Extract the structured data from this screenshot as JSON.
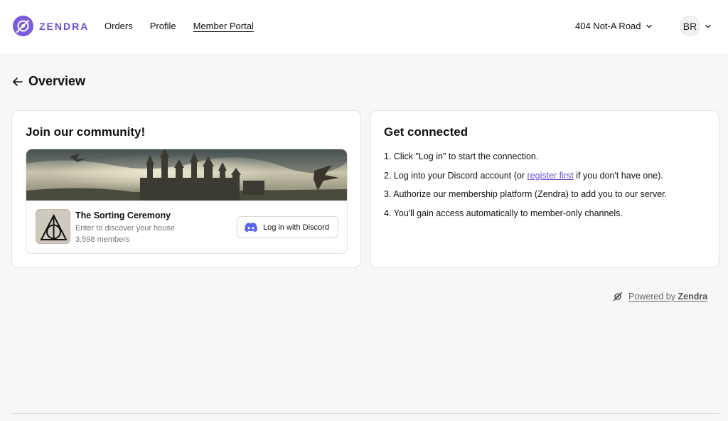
{
  "header": {
    "logo_text": "ZENDRA",
    "nav": [
      {
        "label": "Orders"
      },
      {
        "label": "Profile"
      },
      {
        "label": "Member Portal",
        "active": true
      }
    ],
    "address": "404 Not-A Road",
    "avatar_initials": "BR"
  },
  "page": {
    "title": "Overview",
    "back_icon": "arrow-left-icon"
  },
  "community_card": {
    "title": "Join our community!",
    "server": {
      "name": "The Sorting Ceremony",
      "description": "Enter to discover your house",
      "members": "3,598 members"
    },
    "login_button": "Log in with Discord"
  },
  "connect_card": {
    "title": "Get connected",
    "step1": "1. Click \"Log in\" to start the connection.",
    "step2_before": "2. Log into your Discord account (or ",
    "step2_link": "register first",
    "step2_after": " if you don't have one).",
    "step3": "3. Authorize our membership platform (Zendra) to add you to our server.",
    "step4": "4. You'll gain access automatically to member-only channels."
  },
  "footer": {
    "powered_prefix": "Powered by ",
    "powered_brand": "Zendra"
  },
  "colors": {
    "accent": "#6a4fd2",
    "discord": "#5865f2",
    "background": "#f7f7f7"
  }
}
